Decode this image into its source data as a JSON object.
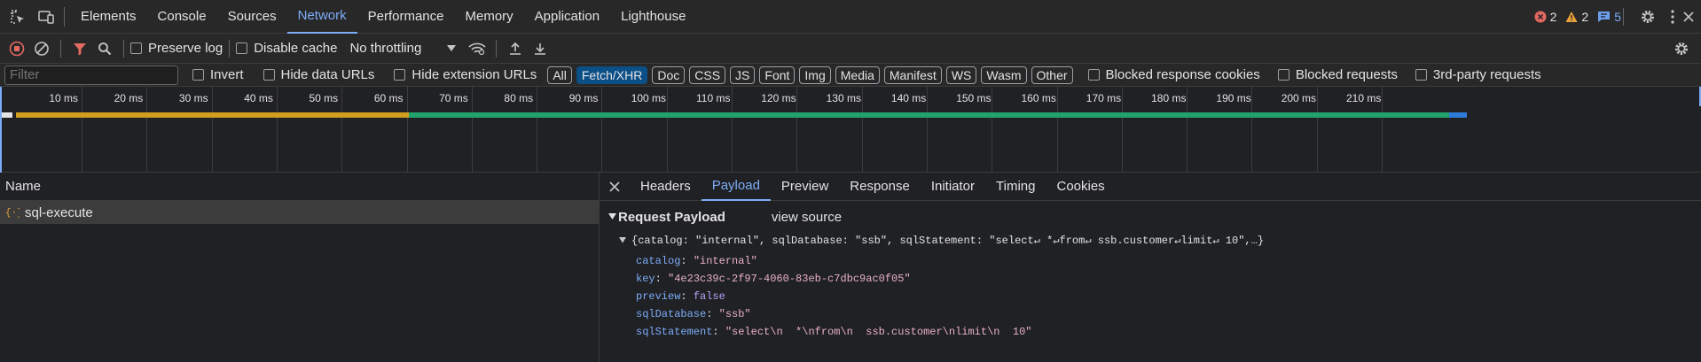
{
  "colors": {
    "accent": "#7cacf8",
    "error": "#e46962",
    "warning": "#e9a23a",
    "info": "#6d9eeb",
    "waterfall_queue": "#d29e1f",
    "waterfall_download": "#21a36b"
  },
  "main_tabs": [
    {
      "label": "Elements"
    },
    {
      "label": "Console"
    },
    {
      "label": "Sources"
    },
    {
      "label": "Network",
      "active": true
    },
    {
      "label": "Performance"
    },
    {
      "label": "Memory"
    },
    {
      "label": "Application"
    },
    {
      "label": "Lighthouse"
    }
  ],
  "badges": {
    "errors": "2",
    "warnings": "2",
    "messages": "5"
  },
  "toolbar": {
    "preserve_log": "Preserve log",
    "disable_cache": "Disable cache",
    "throttling": "No throttling"
  },
  "filter": {
    "placeholder": "Filter",
    "invert": "Invert",
    "hide_data_urls": "Hide data URLs",
    "hide_extension_urls": "Hide extension URLs",
    "types": [
      "All",
      "Fetch/XHR",
      "Doc",
      "CSS",
      "JS",
      "Font",
      "Img",
      "Media",
      "Manifest",
      "WS",
      "Wasm",
      "Other"
    ],
    "active_type": "Fetch/XHR",
    "blocked_cookies": "Blocked response cookies",
    "blocked_requests": "Blocked requests",
    "third_party": "3rd-party requests"
  },
  "timeline_ticks": [
    "10 ms",
    "20 ms",
    "30 ms",
    "40 ms",
    "50 ms",
    "60 ms",
    "70 ms",
    "80 ms",
    "90 ms",
    "100 ms",
    "110 ms",
    "120 ms",
    "130 ms",
    "140 ms",
    "150 ms",
    "160 ms",
    "170 ms",
    "180 ms",
    "190 ms",
    "200 ms",
    "210 ms"
  ],
  "request_list": {
    "header": "Name",
    "rows": [
      {
        "name": "sql-execute"
      }
    ]
  },
  "detail_tabs": [
    {
      "label": "Headers"
    },
    {
      "label": "Payload",
      "active": true
    },
    {
      "label": "Preview"
    },
    {
      "label": "Response"
    },
    {
      "label": "Initiator"
    },
    {
      "label": "Timing"
    },
    {
      "label": "Cookies"
    }
  ],
  "payload": {
    "section_title": "Request Payload",
    "view_source": "view source",
    "summary": "{catalog: \"internal\", sqlDatabase: \"ssb\", sqlStatement: \"select↵ *↵from↵ ssb.customer↵limit↵ 10\",…}",
    "fields": [
      {
        "key": "catalog",
        "value": "\"internal\"",
        "kind": "string"
      },
      {
        "key": "key",
        "value": "\"4e23c39c-2f97-4060-83eb-c7dbc9ac0f05\"",
        "kind": "string"
      },
      {
        "key": "preview",
        "value": "false",
        "kind": "keyword"
      },
      {
        "key": "sqlDatabase",
        "value": "\"ssb\"",
        "kind": "string"
      },
      {
        "key": "sqlStatement",
        "value": "\"select\\n  *\\nfrom\\n  ssb.customer\\nlimit\\n  10\"",
        "kind": "string"
      }
    ]
  }
}
